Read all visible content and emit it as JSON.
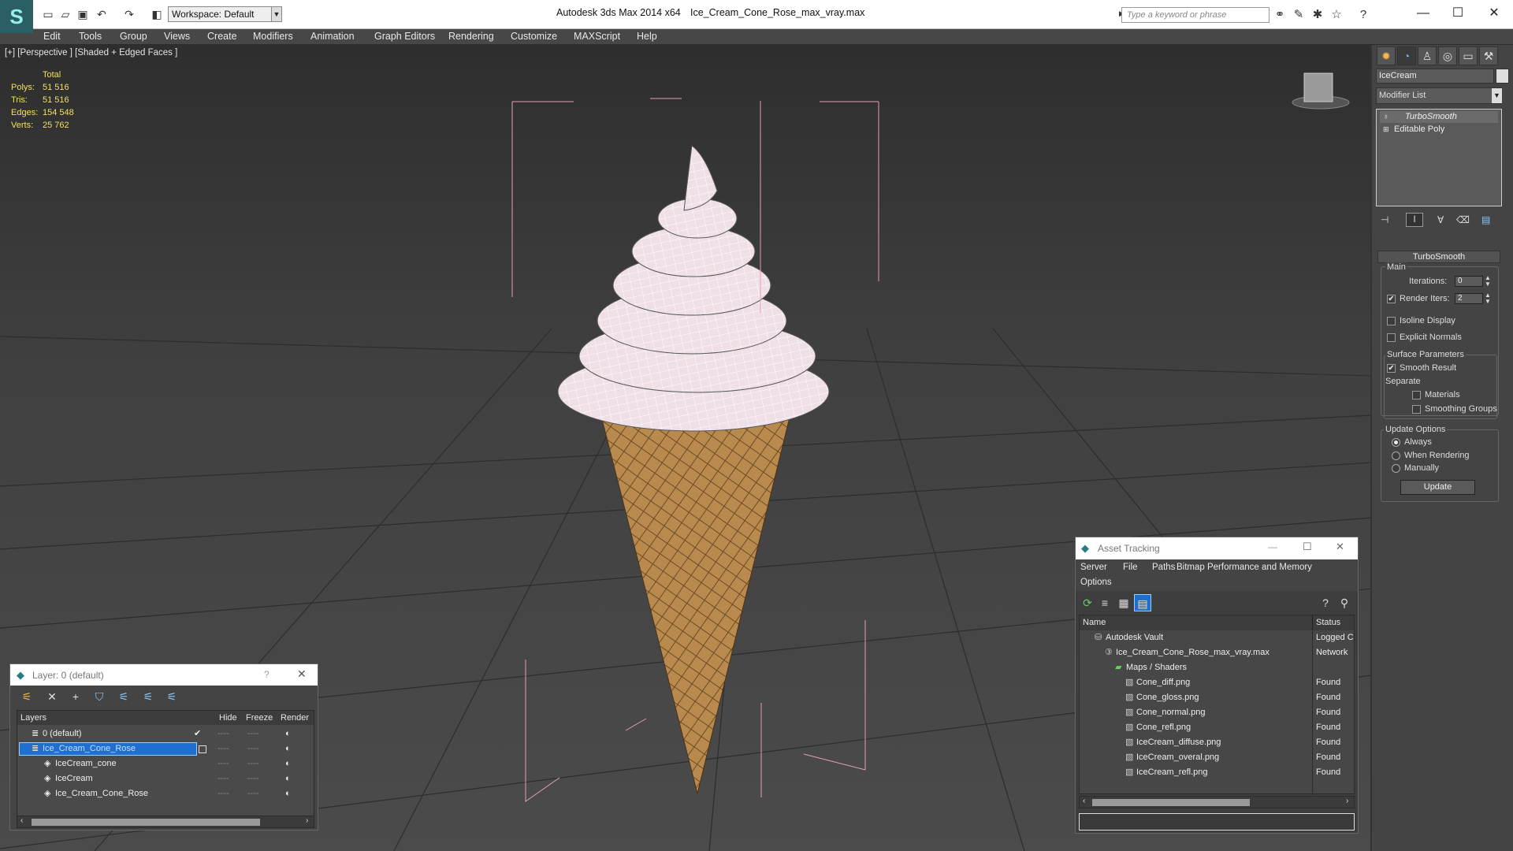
{
  "titlebar": {
    "workspace": "Workspace: Default",
    "app_title": "Autodesk 3ds Max  2014 x64",
    "file_title": "Ice_Cream_Cone_Rose_max_vray.max",
    "search_placeholder": "Type a keyword or phrase"
  },
  "menu": [
    "Edit",
    "Tools",
    "Group",
    "Views",
    "Create",
    "Modifiers",
    "Animation",
    "Graph Editors",
    "Rendering",
    "Customize",
    "MAXScript",
    "Help"
  ],
  "viewport": {
    "label": "[+] [Perspective ] [Shaded + Edged Faces ]",
    "stats_header": "Total",
    "stats": [
      {
        "label": "Polys:",
        "value": "51 516"
      },
      {
        "label": "Tris:",
        "value": "51 516"
      },
      {
        "label": "Edges:",
        "value": "154 548"
      },
      {
        "label": "Verts:",
        "value": "25 762"
      }
    ]
  },
  "command_panel": {
    "object_name": "IceCream",
    "modifier_list": "Modifier List",
    "stack": [
      "TurboSmooth",
      "Editable Poly"
    ],
    "rollout_title": "TurboSmooth",
    "main_label": "Main",
    "iterations_label": "Iterations:",
    "iterations_value": "0",
    "render_iters_label": "Render Iters:",
    "render_iters_value": "2",
    "isoline_label": "Isoline Display",
    "explicit_normals_label": "Explicit Normals",
    "surface_params_label": "Surface Parameters",
    "smooth_result_label": "Smooth Result",
    "separate_label": "Separate",
    "materials_label": "Materials",
    "smoothing_groups_label": "Smoothing Groups",
    "update_options_label": "Update Options",
    "always_label": "Always",
    "when_rendering_label": "When Rendering",
    "manually_label": "Manually",
    "update_button": "Update"
  },
  "layer_window": {
    "title": "Layer: 0 (default)",
    "help": "?",
    "columns": [
      "Layers",
      "Hide",
      "Freeze",
      "Render"
    ],
    "rows": [
      {
        "name": "0 (default)",
        "indent": 0
      },
      {
        "name": "Ice_Cream_Cone_Rose",
        "indent": 0,
        "selected": true
      },
      {
        "name": "IceCream_cone",
        "indent": 1
      },
      {
        "name": "IceCream",
        "indent": 1
      },
      {
        "name": "Ice_Cream_Cone_Rose",
        "indent": 1
      }
    ]
  },
  "asset_window": {
    "title": "Asset Tracking",
    "menus": [
      "Server",
      "File",
      "Paths",
      "Bitmap Performance and Memory"
    ],
    "menu2": "Options",
    "columns": [
      "Name",
      "Status"
    ],
    "rows": [
      {
        "name": "Autodesk Vault",
        "status": "Logged C",
        "indent": 1
      },
      {
        "name": "Ice_Cream_Cone_Rose_max_vray.max",
        "status": "Network",
        "indent": 2
      },
      {
        "name": "Maps / Shaders",
        "status": "",
        "indent": 3
      },
      {
        "name": "Cone_diff.png",
        "status": "Found",
        "indent": 4
      },
      {
        "name": "Cone_gloss.png",
        "status": "Found",
        "indent": 4
      },
      {
        "name": "Cone_normal.png",
        "status": "Found",
        "indent": 4
      },
      {
        "name": "Cone_refl.png",
        "status": "Found",
        "indent": 4
      },
      {
        "name": "IceCream_diffuse.png",
        "status": "Found",
        "indent": 4
      },
      {
        "name": "IceCream_overal.png",
        "status": "Found",
        "indent": 4
      },
      {
        "name": "IceCream_refl.png",
        "status": "Found",
        "indent": 4
      }
    ]
  }
}
